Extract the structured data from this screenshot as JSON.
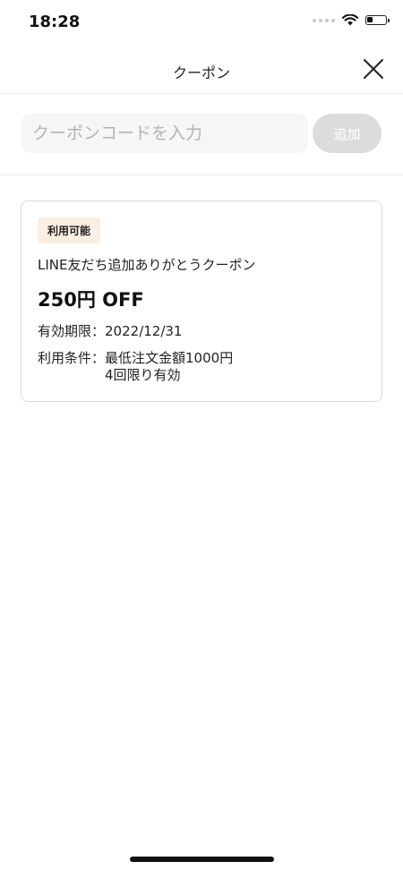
{
  "status_bar": {
    "time": "18:28",
    "battery_level": 0.35
  },
  "header": {
    "title": "クーポン"
  },
  "coupon_form": {
    "placeholder": "クーポンコードを入力",
    "value": "",
    "add_label": "追加"
  },
  "coupon": {
    "status": "利用可能",
    "name": "LINE友だち追加ありがとうクーポン",
    "discount": "250円 OFF",
    "expiry_label": "有効期限：",
    "expiry_value": "2022/12/31",
    "condition_label": "利用条件：",
    "conditions": [
      "最低注文金額1000円",
      "4回限り有効"
    ]
  },
  "colors": {
    "badge_bg": "#fbefe3",
    "button_disabled": "#dddcda",
    "input_bg": "#f7f6f4",
    "card_border": "#dadada"
  }
}
